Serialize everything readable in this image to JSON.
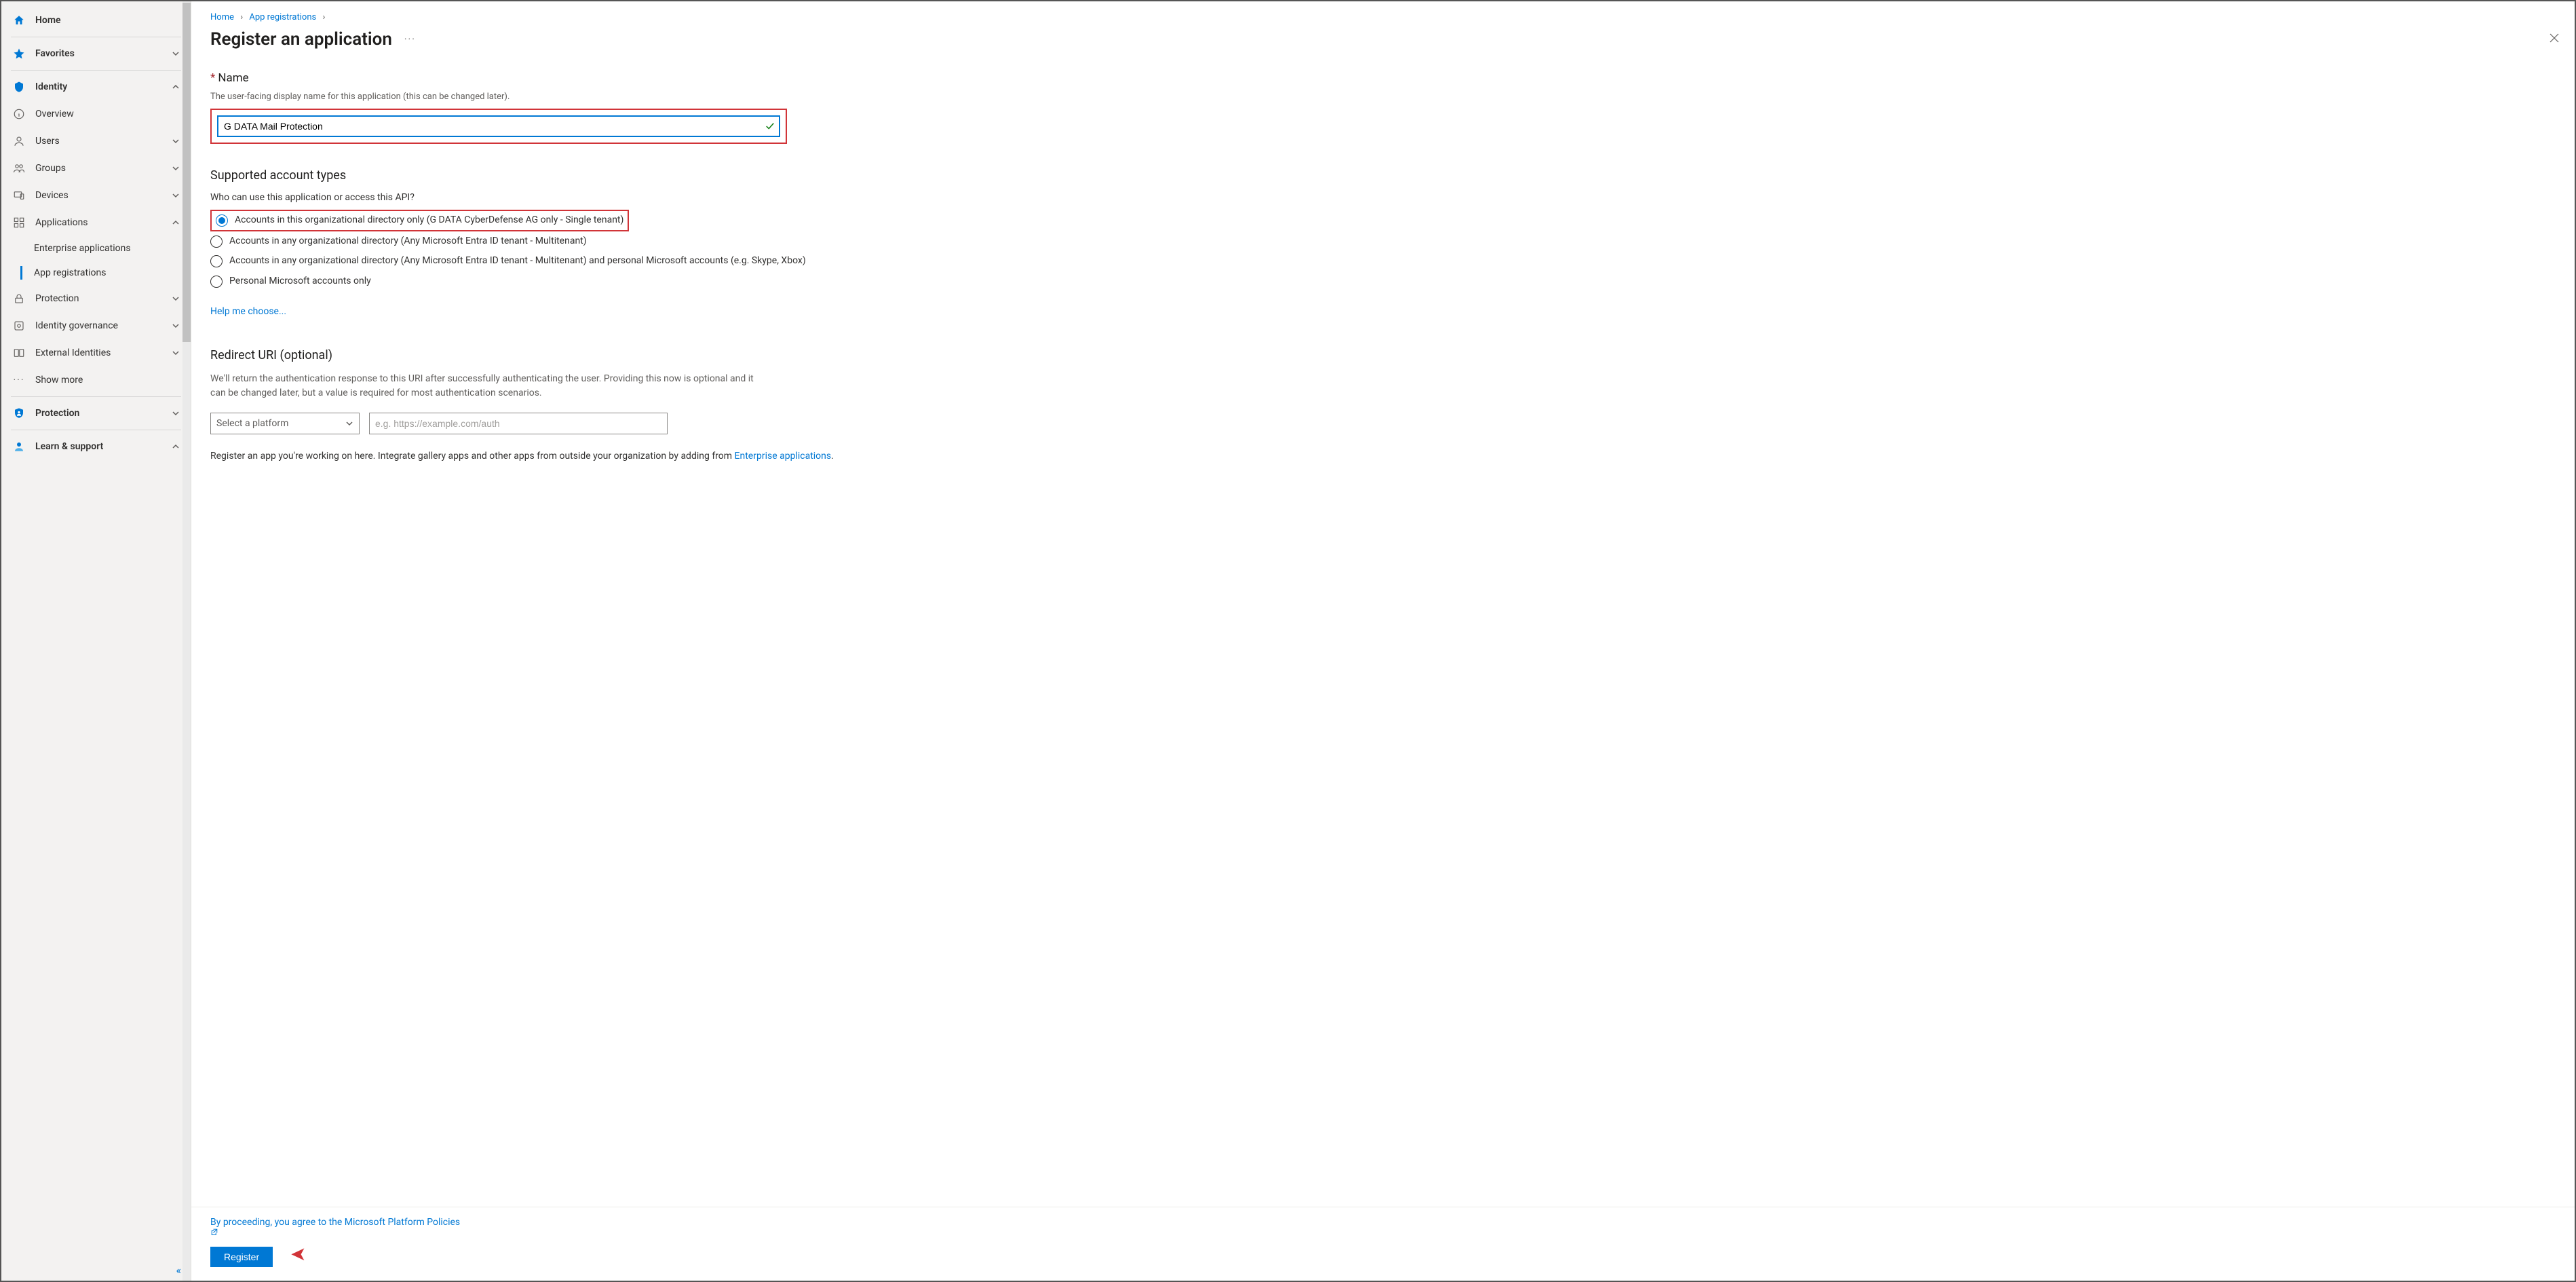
{
  "sidebar": {
    "home": "Home",
    "favorites": "Favorites",
    "identity": "Identity",
    "overview": "Overview",
    "users": "Users",
    "groups": "Groups",
    "devices": "Devices",
    "applications": "Applications",
    "enterprise_apps": "Enterprise applications",
    "app_registrations": "App registrations",
    "protection_group": "Protection",
    "identity_governance": "Identity governance",
    "external_identities": "External Identities",
    "show_more": "Show more",
    "protection_section": "Protection",
    "learn_support": "Learn & support"
  },
  "breadcrumb": {
    "home": "Home",
    "app_reg": "App registrations"
  },
  "header": {
    "title": "Register an application",
    "more": "···"
  },
  "form": {
    "name_label": "Name",
    "name_desc": "The user-facing display name for this application (this can be changed later).",
    "name_value": "G DATA Mail Protection",
    "supported_heading": "Supported account types",
    "supported_sub": "Who can use this application or access this API?",
    "radios": {
      "r1": "Accounts in this organizational directory only (G DATA CyberDefense AG only - Single tenant)",
      "r2": "Accounts in any organizational directory (Any Microsoft Entra ID tenant - Multitenant)",
      "r3": "Accounts in any organizational directory (Any Microsoft Entra ID tenant - Multitenant) and personal Microsoft accounts (e.g. Skype, Xbox)",
      "r4": "Personal Microsoft accounts only"
    },
    "help_link": "Help me choose...",
    "redirect_heading": "Redirect URI (optional)",
    "redirect_desc": "We'll return the authentication response to this URI after successfully authenticating the user. Providing this now is optional and it can be changed later, but a value is required for most authentication scenarios.",
    "platform_placeholder": "Select a platform",
    "uri_placeholder": "e.g. https://example.com/auth",
    "info_line_prefix": "Register an app you're working on here. Integrate gallery apps and other apps from outside your organization by adding from ",
    "info_line_link": "Enterprise applications",
    "agree_text": "By proceeding, you agree to the Microsoft Platform Policies",
    "register_btn": "Register"
  }
}
